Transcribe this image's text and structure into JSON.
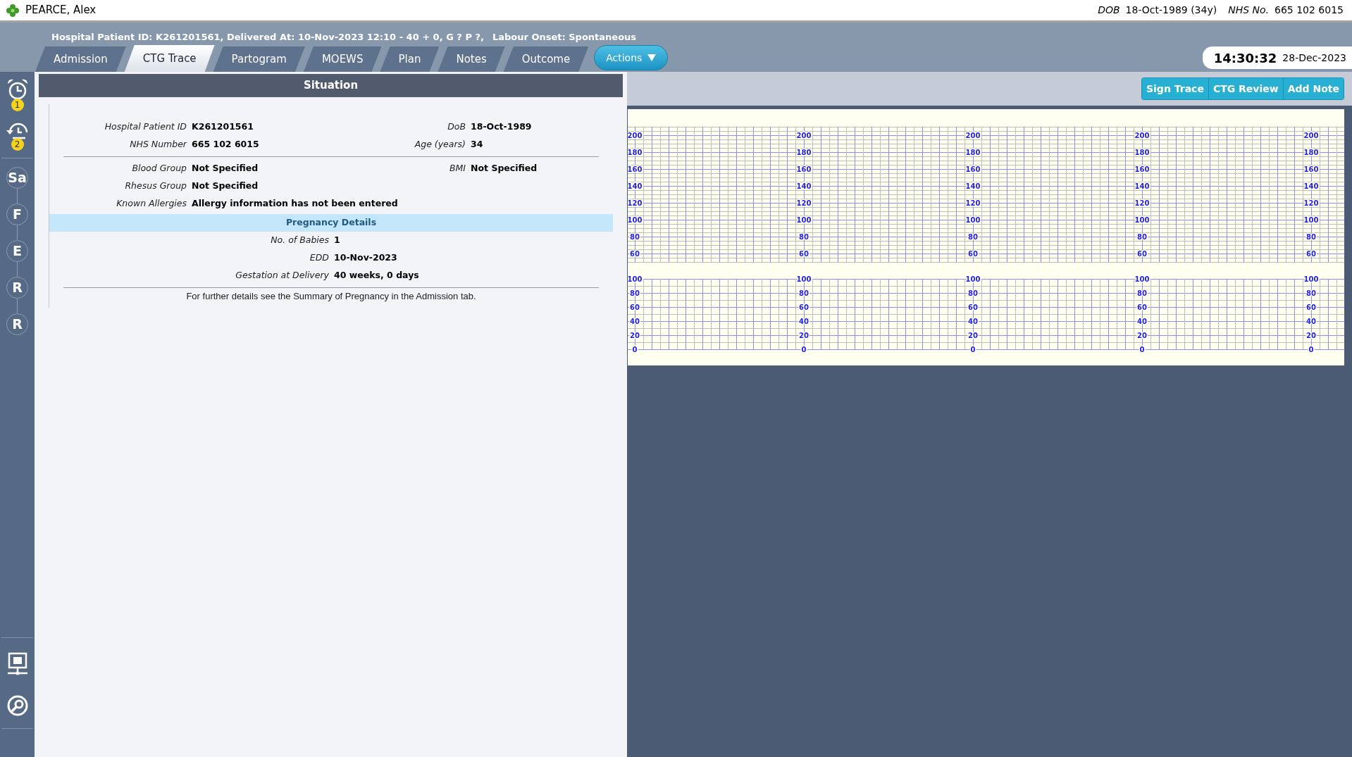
{
  "patient_bar": {
    "name": "PEARCE, Alex",
    "dob_label": "DOB",
    "dob": "18-Oct-1989 (34y)",
    "nhs_label": "NHS No.",
    "nhs": "665 102 6015"
  },
  "header": {
    "info": "Hospital Patient ID: K261201561, Delivered At: 10-Nov-2023 12:10 - 40 + 0, G ? P ?,",
    "labour_onset": "Labour Onset: Spontaneous"
  },
  "tabs": [
    {
      "label": "Admission",
      "selected": false
    },
    {
      "label": "CTG Trace",
      "selected": true
    },
    {
      "label": "Partogram",
      "selected": false
    },
    {
      "label": "MOEWS",
      "selected": false
    },
    {
      "label": "Plan",
      "selected": false
    },
    {
      "label": "Notes",
      "selected": false
    },
    {
      "label": "Outcome",
      "selected": false
    }
  ],
  "actions_button": {
    "label": "Actions"
  },
  "clock": {
    "time": "14:30:32",
    "date": "28-Dec-2023"
  },
  "sidebar": {
    "alarms": [
      {
        "kind": "alarm",
        "badge": "1"
      },
      {
        "kind": "history",
        "badge": "2"
      }
    ],
    "steps": [
      "Sa",
      "F",
      "E",
      "R",
      "R"
    ],
    "tools": [
      {
        "kind": "monitor"
      },
      {
        "kind": "search"
      }
    ]
  },
  "situation": {
    "title": "Situation",
    "identity_rows": [
      [
        {
          "label": "Hospital Patient ID",
          "value": "K261201561"
        },
        {
          "label": "DoB",
          "value": "18-Oct-1989"
        }
      ],
      [
        {
          "label": "NHS Number",
          "value": "665 102 6015"
        },
        {
          "label": "Age (years)",
          "value": "34"
        }
      ]
    ],
    "clinical_rows": [
      [
        {
          "label": "Blood Group",
          "value": "Not Specified"
        },
        {
          "label": "BMI",
          "value": "Not Specified"
        }
      ],
      [
        {
          "label": "Rhesus Group",
          "value": "Not Specified"
        }
      ],
      [
        {
          "label": "Known Allergies",
          "value": "Allergy information has not been entered"
        }
      ]
    ],
    "pregnancy": {
      "title": "Pregnancy Details",
      "rows": [
        {
          "label": "No. of Babies",
          "value": "1"
        },
        {
          "label": "EDD",
          "value": "10-Nov-2023"
        },
        {
          "label": "Gestation at Delivery",
          "value": "40 weeks, 0 days"
        }
      ]
    },
    "footer": "For further details see the Summary of Pregnancy in the Admission tab."
  },
  "trace_buttons": [
    "Sign Trace",
    "CTG Review",
    "Add Note"
  ],
  "ctg": {
    "segments": [
      {
        "fhr_labels": [
          "200",
          "180",
          "160",
          "140",
          "120",
          "100",
          "80",
          "60"
        ],
        "toco_labels": [
          "100",
          "80",
          "60",
          "40",
          "20",
          "0"
        ]
      },
      {
        "fhr_labels": [
          "200",
          "180",
          "160",
          "140",
          "120",
          "100",
          "80",
          "60"
        ],
        "toco_labels": [
          "100",
          "80",
          "60",
          "40",
          "20",
          "0"
        ]
      },
      {
        "fhr_labels": [
          "200",
          "180",
          "160",
          "140",
          "120",
          "100",
          "80",
          "60"
        ],
        "toco_labels": [
          "100",
          "80",
          "60",
          "40",
          "20",
          "0"
        ]
      },
      {
        "fhr_labels": [
          "200",
          "180",
          "160",
          "140",
          "120",
          "100",
          "80",
          "60"
        ],
        "toco_labels": [
          "100",
          "80",
          "60",
          "40",
          "20",
          "0"
        ]
      },
      {
        "fhr_labels": [
          "200",
          "180",
          "160",
          "140",
          "120",
          "100",
          "80",
          "60"
        ],
        "toco_labels": [
          "100",
          "80",
          "60",
          "40",
          "20",
          "0"
        ]
      }
    ]
  }
}
